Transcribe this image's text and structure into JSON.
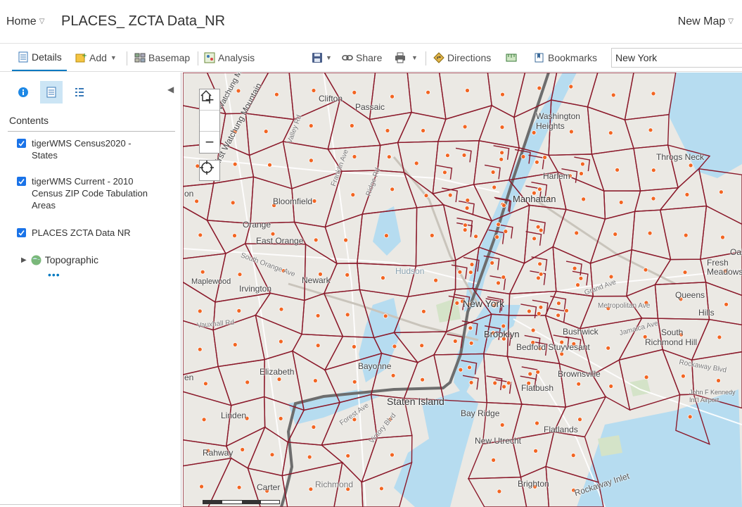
{
  "header": {
    "home_label": "Home",
    "map_title": "PLACES_ ZCTA Data_NR",
    "new_map_label": "New Map"
  },
  "toolbar": {
    "details": "Details",
    "add": "Add",
    "basemap": "Basemap",
    "analysis": "Analysis",
    "share": "Share",
    "directions": "Directions",
    "bookmarks": "Bookmarks",
    "search_value": "New York"
  },
  "sidebar": {
    "contents_heading": "Contents",
    "layers": [
      {
        "label": "tigerWMS Census2020 - States",
        "checked": true
      },
      {
        "label": "tigerWMS Current - 2010 Census ZIP Code Tabulation Areas",
        "checked": true
      },
      {
        "label": "PLACES ZCTA Data NR",
        "checked": true
      }
    ],
    "basemap_label": "Topographic",
    "more": "•••"
  },
  "map": {
    "labels": {
      "clifton": "Clifton",
      "passaic": "Passaic",
      "bloomfield": "Bloomfield",
      "orange": "Orange",
      "east_orange": "East Orange",
      "maplewood": "Maplewood",
      "irvington": "Irvington",
      "newark": "Newark",
      "elizabeth": "Elizabeth",
      "linden": "Linden",
      "rahway": "Rahway",
      "carteret": "Carter",
      "bayonne": "Bayonne",
      "staten_island": "Staten Island",
      "richmond": "Richmond",
      "new_york": "New York",
      "manhattan": "Manhattan",
      "washington_heights": "Washington Heights",
      "harlem": "Harlem",
      "brooklyn": "Brooklyn",
      "bushwick": "Bushwick",
      "bed_stuy": "Bedford Stuyvesant",
      "brownsville": "Brownsville",
      "flatbush": "Flatbush",
      "bay_ridge": "Bay Ridge",
      "new_utrecht": "New Utrecht",
      "flatlands": "Flatlands",
      "brighton": "Brighton",
      "queens": "Queens",
      "richmond_hill": "Richmond Hill",
      "south": "South",
      "fresh_meadows": "Fresh Meadows",
      "hillside": "Hills",
      "throgs_neck": "Throgs Neck",
      "hudson": "Hudson",
      "jfk": "John F Kennedy Int'l Airport",
      "rockaway_inlet": "Rockaway Inlet",
      "first_watchung": "First Watchung Mountain",
      "second_watchung": "Second Watchung Mountain",
      "oak": "Oak",
      "on": "on",
      "en": "en"
    },
    "roads": {
      "franklin_ave": "Franklin Ave",
      "ridge_rd": "Ridge Rd",
      "valley_rd": "Valley Rd",
      "south_orange_ave": "South Orange Ave",
      "vauxhall_rd": "Vauxhall Rd",
      "grand_ave": "Grand Ave",
      "metropolitan_ave": "Metropolitan Ave",
      "jamaica_ave": "Jamaica Ave",
      "rockaway_blvd": "Rockaway Blvd",
      "victory_blvd": "Victory Blvd",
      "forest_ave": "Forest Ave"
    }
  },
  "colors": {
    "zcta_border": "#8b1a2b",
    "water": "#b6dcf0",
    "point": "#f26522",
    "accent": "#0079c1"
  }
}
